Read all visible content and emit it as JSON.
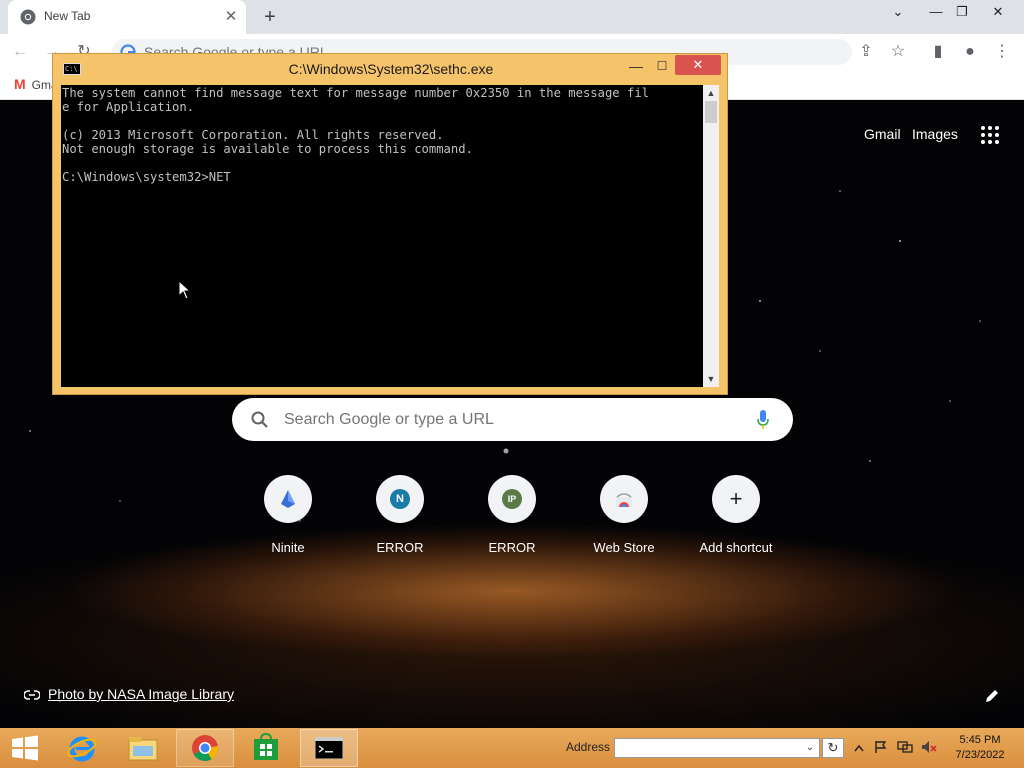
{
  "browser": {
    "tab": {
      "title": "New Tab",
      "close": "✕"
    },
    "new_tab": "+",
    "window_buttons": {
      "collapse": "⌄",
      "minimize": "—",
      "restore": "❐",
      "close": "✕"
    },
    "nav": {
      "back": "←",
      "forward": "→",
      "reload": "↻"
    },
    "omnibox_placeholder": "Search Google or type a URL",
    "toolbar_icons": {
      "share": "⇪",
      "star": "☆",
      "sidepanel": "▮",
      "profile": "●",
      "menu": "⋮"
    },
    "bookmark": "Gmail"
  },
  "ntp": {
    "gmail": "Gmail",
    "images": "Images",
    "search_placeholder": "Search Google or type a URL",
    "shortcuts": [
      {
        "label": "Ninite",
        "badge": ""
      },
      {
        "label": "ERROR",
        "badge": "N"
      },
      {
        "label": "ERROR",
        "badge": "IP"
      },
      {
        "label": "Web Store",
        "badge": ""
      },
      {
        "label": "Add shortcut",
        "badge": "+"
      }
    ],
    "photo_credit": "Photo by NASA Image Library"
  },
  "console": {
    "title": "C:\\Windows\\System32\\sethc.exe",
    "icon_text": "C:\\",
    "buttons": {
      "minimize": "—",
      "maximize": "☐",
      "close": "✕"
    },
    "lines": [
      "The system cannot find message text for message number 0x2350 in the message fil",
      "e for Application.",
      "",
      "(c) 2013 Microsoft Corporation. All rights reserved.",
      "Not enough storage is available to process this command.",
      "",
      "C:\\Windows\\system32>NET"
    ],
    "scroll_up": "▲",
    "scroll_down": "▼"
  },
  "taskbar": {
    "address_label": "Address",
    "address_value": "",
    "address_dropdown": "⌄",
    "go": "↻",
    "clock_time": "5:45 PM",
    "clock_date": "7/23/2022"
  },
  "colors": {
    "console_frame": "#f4c36a",
    "taskbar": "#e0a04e",
    "ntp_background": "#030305"
  }
}
